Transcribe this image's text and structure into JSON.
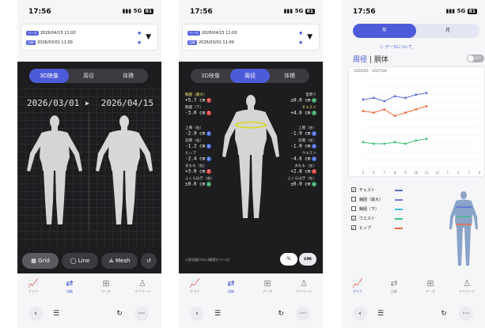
{
  "status": {
    "time": "17:56",
    "signal": "5G",
    "battery": "81"
  },
  "dates": {
    "row1": {
      "tag": "ベース",
      "date": "2026/04/15 11:00",
      "tag_color": "#5562de"
    },
    "row2": {
      "tag": "比較",
      "date": "2026/03/01 11:00",
      "tag_color": "#5562de"
    },
    "dropdown_icon": "caret-down-icon"
  },
  "view_tabs": {
    "model": "3D映像",
    "girth": "周径",
    "volume": "体積"
  },
  "compare": {
    "from": "2026/03/01",
    "arrow": "▶",
    "to": "2026/04/15"
  },
  "tools": {
    "grid": "Grid",
    "line": "Line",
    "mesh": "Mesh"
  },
  "measurements": {
    "left": [
      {
        "label": "胸囲（最大）",
        "value": "+5.7 cm",
        "dir": "up"
      },
      {
        "label": "胸囲（下）",
        "value": "-3.0 cm",
        "dir": "up"
      },
      {
        "label": "上腕（右）",
        "value": "-2.9 cm",
        "dir": "down"
      },
      {
        "label": "前腕（右）",
        "value": "-1.2 cm",
        "dir": "down"
      },
      {
        "label": "ヒップ",
        "value": "-2.4 cm",
        "dir": "down"
      },
      {
        "label": "太もも（右）",
        "value": "+3.0 cm",
        "dir": "up"
      },
      {
        "label": "ふくらはぎ（右）",
        "value": "±0.0 cm",
        "dir": "eq"
      }
    ],
    "right": [
      {
        "label": "首周り",
        "value": "±0.0 cm",
        "dir": "eq"
      },
      {
        "label": "チェスト",
        "value": "+4.6 cm",
        "dir": "up"
      },
      {
        "label": "上腕（左）",
        "value": "-1.9 cm",
        "dir": "down"
      },
      {
        "label": "前腕（左）",
        "value": "-1.0 cm",
        "dir": "down"
      },
      {
        "label": "ウエスト",
        "value": "-4.6 cm",
        "dir": "down"
      },
      {
        "label": "太もも（左）",
        "value": "+2.8 cm",
        "dir": "up"
      },
      {
        "label": "ふくらはぎ（左）",
        "value": "±0.0 cm",
        "dir": "eq"
      }
    ],
    "note": "＊変化量(cm)=[最適]-[ベース]",
    "pct": "%",
    "cm": "cm"
  },
  "nav": [
    {
      "label": "グラフ",
      "icon": "chart-icon"
    },
    {
      "label": "比較",
      "icon": "swap-icon"
    },
    {
      "label": "データ",
      "icon": "book-icon"
    },
    {
      "label": "マイページ",
      "icon": "person-icon"
    }
  ],
  "browser": {
    "back": "‹",
    "tabs": "☰",
    "reload": "↻",
    "more": "⋯"
  },
  "graph": {
    "period_tabs": {
      "month": "年",
      "other": "月"
    },
    "link": "ⓘ データについて",
    "title_main": "周径",
    "title_sub": "胴体",
    "toggle": "OFF",
    "chart_title": "2026/05 - 2027/04",
    "legend": [
      {
        "name": "チェスト",
        "checked": true,
        "color": "#5a6fd8"
      },
      {
        "name": "胸囲（最大）",
        "checked": false,
        "color": "#6a7ae0"
      },
      {
        "name": "胸囲（下）",
        "checked": false,
        "color": "#33c0e0"
      },
      {
        "name": "ウエスト",
        "checked": true,
        "color": "#3cc27a"
      },
      {
        "name": "ヒップ",
        "checked": true,
        "color": "#f06a3a"
      }
    ]
  },
  "chart_data": {
    "type": "line",
    "title": "2026/05 - 2027/04",
    "x": [
      "5",
      "6",
      "7",
      "8",
      "9",
      "10",
      "11",
      "12",
      "1",
      "2",
      "3",
      "4"
    ],
    "series": [
      {
        "name": "チェスト",
        "color": "#5a6fd8",
        "values": [
          112,
          113,
          111,
          114,
          113,
          115,
          116,
          null,
          null,
          null,
          null,
          null
        ]
      },
      {
        "name": "ヒップ",
        "color": "#f06a3a",
        "values": [
          105,
          104,
          106,
          102,
          104,
          106,
          108,
          null,
          null,
          null,
          null,
          null
        ]
      },
      {
        "name": "ウエスト",
        "color": "#3cc27a",
        "values": [
          86,
          85,
          85,
          86,
          85,
          87,
          88,
          null,
          null,
          null,
          null,
          null
        ]
      }
    ],
    "ylim": [
      70,
      125
    ]
  },
  "colors": {
    "accent": "#4e5bd8",
    "up": "#e04848",
    "down": "#4a6ee0",
    "eq": "#3aa76d"
  }
}
